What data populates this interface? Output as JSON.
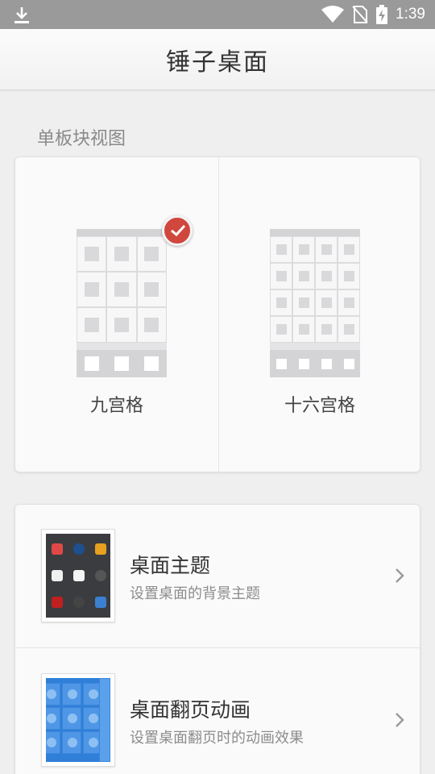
{
  "status_bar": {
    "time": "1:39",
    "icons": [
      "download-icon",
      "wifi-icon",
      "no-sim-icon",
      "battery-charging-icon"
    ]
  },
  "header": {
    "title": "锤子桌面"
  },
  "grid_section": {
    "label": "单板块视图",
    "options": [
      {
        "label": "九宫格",
        "selected": true
      },
      {
        "label": "十六宫格",
        "selected": false
      }
    ]
  },
  "settings": [
    {
      "title": "桌面主题",
      "subtitle": "设置桌面的背景主题"
    },
    {
      "title": "桌面翻页动画",
      "subtitle": "设置桌面翻页时的动画效果"
    }
  ],
  "colors": {
    "accent": "#d0473d",
    "background": "#efefef",
    "status_bar": "#9a9a9a"
  }
}
